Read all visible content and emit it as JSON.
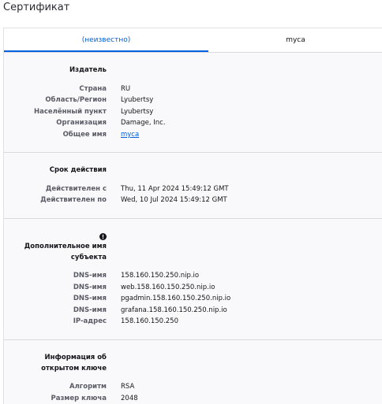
{
  "page_title": "Сертификат",
  "tabs": [
    {
      "label": "(неизвестно)",
      "active": true
    },
    {
      "label": "myca",
      "active": false
    }
  ],
  "issuer": {
    "heading": "Издатель",
    "rows": [
      {
        "label": "Страна",
        "value": "RU"
      },
      {
        "label": "Область/Регион",
        "value": "Lyubertsy"
      },
      {
        "label": "Населённый пункт",
        "value": "Lyubertsy"
      },
      {
        "label": "Организация",
        "value": "Damage, Inc."
      },
      {
        "label": "Общее имя",
        "value": "myca"
      }
    ]
  },
  "validity": {
    "heading": "Срок действия",
    "rows": [
      {
        "label": "Действителен с",
        "value": "Thu, 11 Apr 2024 15:49:12 GMT"
      },
      {
        "label": "Действителен по",
        "value": "Wed, 10 Jul 2024 15:49:12 GMT"
      }
    ]
  },
  "san": {
    "heading_line1": "Дополнительное имя",
    "heading_line2": "субъекта",
    "icon": "warning-icon",
    "rows": [
      {
        "label": "DNS-имя",
        "value": "158.160.150.250.nip.io"
      },
      {
        "label": "DNS-имя",
        "value": "web.158.160.150.250.nip.io"
      },
      {
        "label": "DNS-имя",
        "value": "pgadmin.158.160.150.250.nip.io"
      },
      {
        "label": "DNS-имя",
        "value": "grafana.158.160.150.250.nip.io"
      },
      {
        "label": "IP-адрес",
        "value": "158.160.150.250"
      }
    ]
  },
  "public_key": {
    "heading_line1": "Информация об",
    "heading_line2": "открытом ключе",
    "rows": [
      {
        "label": "Алгоритм",
        "value": "RSA"
      },
      {
        "label": "Размер ключа",
        "value": "2048"
      }
    ]
  },
  "colors": {
    "accent": "#0061e0",
    "panel_bg": "#f9f9fb",
    "label": "#5b5b66"
  }
}
